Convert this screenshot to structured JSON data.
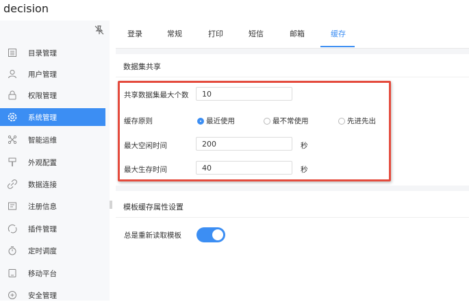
{
  "app": {
    "title": "decision"
  },
  "sidebar": {
    "pin_icon": "pin-off-icon",
    "items": [
      {
        "label": "目录管理",
        "icon": "list-icon"
      },
      {
        "label": "用户管理",
        "icon": "user-icon"
      },
      {
        "label": "权限管理",
        "icon": "lock-icon"
      },
      {
        "label": "系统管理",
        "icon": "gear-icon",
        "active": true
      },
      {
        "label": "智能运维",
        "icon": "network-icon"
      },
      {
        "label": "外观配置",
        "icon": "brush-icon"
      },
      {
        "label": "数据连接",
        "icon": "link-icon"
      },
      {
        "label": "注册信息",
        "icon": "register-icon"
      },
      {
        "label": "插件管理",
        "icon": "plugin-icon"
      },
      {
        "label": "定时调度",
        "icon": "timer-icon"
      },
      {
        "label": "移动平台",
        "icon": "mobile-icon"
      },
      {
        "label": "安全管理",
        "icon": "shield-icon"
      }
    ]
  },
  "tabs": [
    {
      "label": "登录"
    },
    {
      "label": "常规"
    },
    {
      "label": "打印"
    },
    {
      "label": "短信"
    },
    {
      "label": "邮箱"
    },
    {
      "label": "缓存",
      "active": true
    }
  ],
  "dataset_share": {
    "title": "数据集共享",
    "max_count_label": "共享数据集最大个数",
    "max_count_value": "10",
    "cache_policy_label": "缓存原则",
    "policies": [
      {
        "label": "最近使用",
        "checked": true
      },
      {
        "label": "最不常使用",
        "checked": false
      },
      {
        "label": "先进先出",
        "checked": false
      }
    ],
    "max_idle_label": "最大空闲时间",
    "max_idle_value": "200",
    "max_idle_unit": "秒",
    "max_live_label": "最大生存时间",
    "max_live_value": "40",
    "max_live_unit": "秒"
  },
  "template_cache": {
    "title": "模板缓存属性设置",
    "reload_label": "总是重新读取模板",
    "reload_enabled": true
  },
  "colors": {
    "accent": "#3c8ef3",
    "highlight": "#e44b3d"
  }
}
